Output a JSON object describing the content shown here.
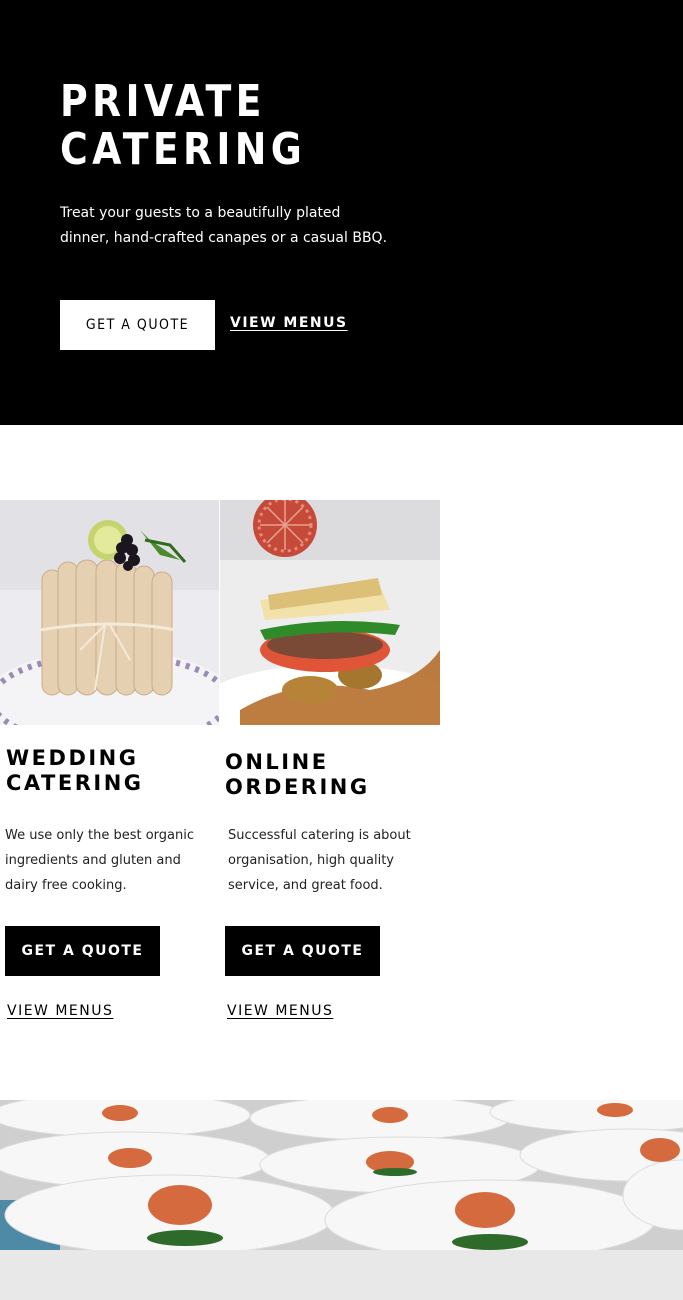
{
  "hero": {
    "title_line1": "PRIVATE",
    "title_line2": "CATERING",
    "description": "Treat your guests to a beautifully plated dinner, hand-crafted canapes or a casual BBQ.",
    "quote_button": "GET A QUOTE",
    "menus_link": "VIEW MENUS"
  },
  "cards": [
    {
      "image_name": "wedding-cake-dessert-image",
      "title_line1": "WEDDING",
      "title_line2": "CATERING",
      "description": "We use only the best organic ingredients and gluten and dairy free cooking.",
      "quote_button": "GET A QUOTE",
      "menus_link": "VIEW MENUS"
    },
    {
      "image_name": "plated-fish-dish-image",
      "title_line1": "ONLINE",
      "title_line2": "ORDERING",
      "description": "Successful catering is about organisation, high quality service, and great food.",
      "quote_button": "GET A QUOTE",
      "menus_link": "VIEW MENUS"
    }
  ],
  "banner": {
    "image_name": "plated-canapes-banner-image"
  },
  "colors": {
    "hero_bg": "#000000",
    "button_black": "#000000",
    "button_white": "#ffffff",
    "footer_strip": "#e8e8e8"
  }
}
